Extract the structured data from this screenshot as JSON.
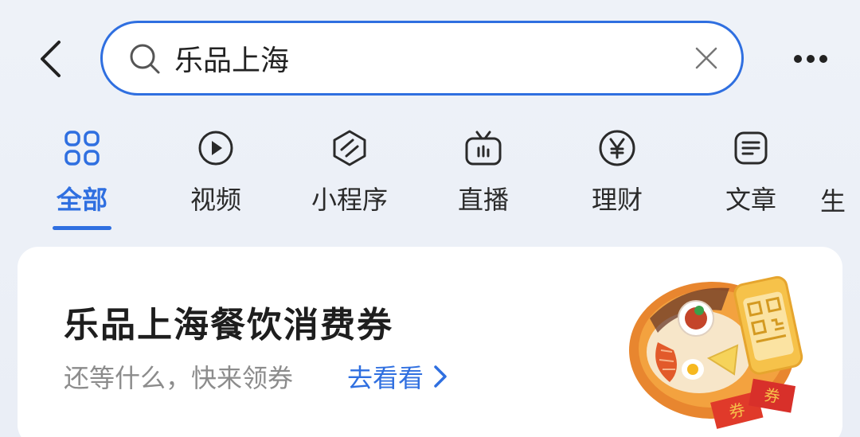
{
  "header": {
    "search": {
      "value": "乐品上海"
    }
  },
  "tabs": [
    {
      "label": "全部",
      "icon": "grid-icon",
      "active": true
    },
    {
      "label": "视频",
      "icon": "play-icon",
      "active": false
    },
    {
      "label": "小程序",
      "icon": "mini-program-icon",
      "active": false
    },
    {
      "label": "直播",
      "icon": "tv-icon",
      "active": false
    },
    {
      "label": "理财",
      "icon": "yen-icon",
      "active": false
    },
    {
      "label": "文章",
      "icon": "document-icon",
      "active": false
    },
    {
      "label": "生",
      "icon": "",
      "active": false
    }
  ],
  "card": {
    "title": "乐品上海餐饮消费券",
    "subtitle": "还等什么，快来领券",
    "link_label": "去看看",
    "illustration_text": "券"
  },
  "colors": {
    "accent": "#2f6fe0",
    "title": "#1e1e1e",
    "subtitle": "#8c8c8c"
  }
}
